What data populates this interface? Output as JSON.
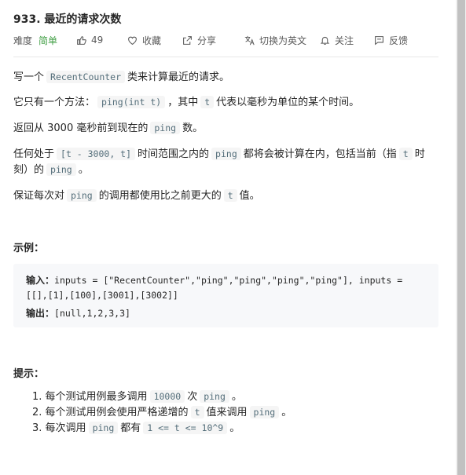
{
  "problem": {
    "title": "933. 最近的请求次数"
  },
  "toolbar": {
    "difficulty_label": "难度",
    "difficulty_value": "简单",
    "likes": "49",
    "favorite": "收藏",
    "share": "分享",
    "switch_lang": "切换为英文",
    "follow": "关注",
    "feedback": "反馈"
  },
  "desc": {
    "p1_a": "写一个",
    "p1_code": "RecentCounter",
    "p1_b": "类来计算最近的请求。",
    "p2_a": "它只有一个方法：",
    "p2_code": "ping(int t)",
    "p2_b": "，其中",
    "p2_code2": "t",
    "p2_c": "代表以毫秒为单位的某个时间。",
    "p3_a": "返回从 3000 毫秒前到现在的",
    "p3_code": "ping",
    "p3_b": "数。",
    "p4_a": "任何处于",
    "p4_code": "[t - 3000, t]",
    "p4_b": "时间范围之内的",
    "p4_code2": "ping",
    "p4_c": "都将会被计算在内，包括当前（指",
    "p4_code3": "t",
    "p4_d": "时",
    "p4_e": "刻）的",
    "p4_code4": "ping",
    "p4_f": "。",
    "p5_a": "保证每次对",
    "p5_code": "ping",
    "p5_b": "的调用都使用比之前更大的",
    "p5_code2": "t",
    "p5_c": "值。"
  },
  "example": {
    "heading": "示例：",
    "input_label": "输入：",
    "input_line1": "inputs = [\"RecentCounter\",\"ping\",\"ping\",\"ping\",\"ping\"], inputs =",
    "input_line2": "[[],[1],[100],[3001],[3002]]",
    "output_label": "输出：",
    "output_value": "[null,1,2,3,3]"
  },
  "hints": {
    "heading": "提示：",
    "h1_num": "1.",
    "h1_a": "每个测试用例最多调用",
    "h1_code": "10000",
    "h1_b": "次",
    "h1_code2": "ping",
    "h1_c": "。",
    "h2_num": "2.",
    "h2_a": "每个测试用例会使用严格递增的",
    "h2_code": "t",
    "h2_b": "值来调用",
    "h2_code2": "ping",
    "h2_c": "。",
    "h3_num": "3.",
    "h3_a": "每次调用",
    "h3_code": "ping",
    "h3_b": "都有",
    "h3_code2": "1 <= t <= 10^9",
    "h3_c": "。"
  },
  "colors": {
    "easy": "#43a047",
    "code_bg": "#f5f5f5",
    "code_fg": "#546e7a"
  }
}
